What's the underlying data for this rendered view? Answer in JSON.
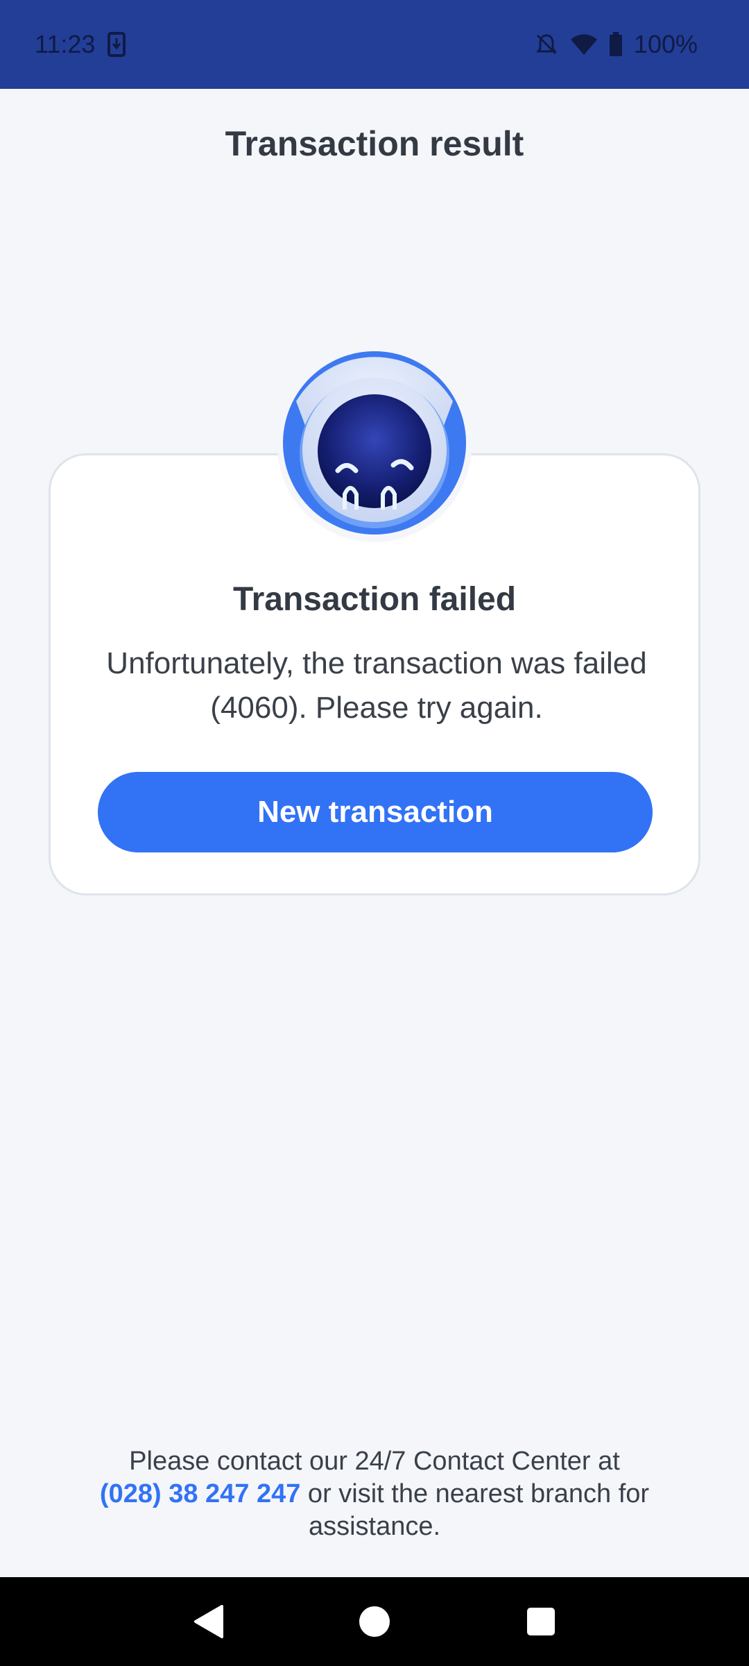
{
  "status_bar": {
    "time": "11:23",
    "battery": "100%",
    "icons": [
      "download-icon",
      "bell-off-icon",
      "wifi-icon",
      "battery-icon"
    ]
  },
  "header": {
    "title": "Transaction result"
  },
  "result_card": {
    "icon": "failed-mascot-icon",
    "title": "Transaction failed",
    "message": "Unfortunately, the transaction was failed (4060). Please try again.",
    "button_label": "New transaction"
  },
  "footer": {
    "line1": "Please contact our 24/7 Contact Center at",
    "phone": "(028) 38 247 247",
    "line2": " or visit the nearest branch for assistance."
  },
  "nav": {
    "icons": [
      "back-icon",
      "home-icon",
      "recents-icon"
    ]
  },
  "colors": {
    "status_bar": "#233e97",
    "accent": "#3272f5",
    "background": "#f4f6fa"
  }
}
